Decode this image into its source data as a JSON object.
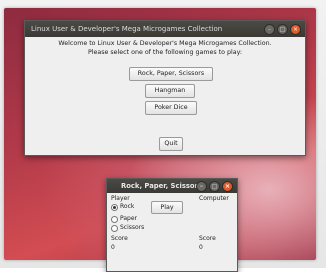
{
  "main_window": {
    "title": "Linux User & Developer's Mega Microgames Collection",
    "intro_line1": "Welcome to Linux User & Developer's Mega Microgames Collection.",
    "intro_line2": "Please select one of the following games to play:",
    "buttons": {
      "rps": "Rock, Paper, Scissors",
      "hangman": "Hangman",
      "poker_dice": "Poker Dice",
      "quit": "Quit"
    }
  },
  "rps_window": {
    "title": "Rock, Paper, Scissors",
    "player_label": "Player",
    "computer_label": "Computer",
    "options": [
      {
        "label": "Rock",
        "selected": true
      },
      {
        "label": "Paper",
        "selected": false
      },
      {
        "label": "Scissors",
        "selected": false
      }
    ],
    "play_button": "Play",
    "player_score_label": "Score",
    "player_score_value": "0",
    "computer_score_label": "Score",
    "computer_score_value": "0"
  },
  "colors": {
    "titlebar": "#3f3e3a",
    "window_bg": "#efefef",
    "close_button": "#e05a2a",
    "wallpaper": "#b23a4a"
  }
}
